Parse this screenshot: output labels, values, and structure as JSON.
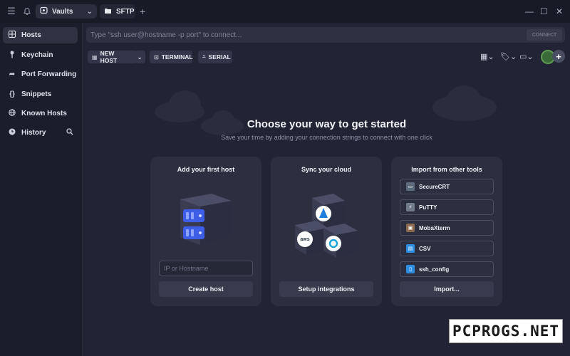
{
  "titlebar": {
    "tabs": [
      {
        "label": "Vaults",
        "icon": "vault-icon"
      },
      {
        "label": "SFTP",
        "icon": "folder-icon"
      }
    ]
  },
  "sidebar": {
    "items": [
      {
        "label": "Hosts",
        "icon": "grid-icon",
        "active": true
      },
      {
        "label": "Keychain",
        "icon": "key-icon"
      },
      {
        "label": "Port Forwarding",
        "icon": "arrow-forward-icon"
      },
      {
        "label": "Snippets",
        "icon": "braces-icon"
      },
      {
        "label": "Known Hosts",
        "icon": "globe-icon"
      },
      {
        "label": "History",
        "icon": "clock-icon"
      }
    ]
  },
  "connect": {
    "placeholder": "Type \"ssh user@hostname -p port\" to connect...",
    "button_label": "CONNECT"
  },
  "toolbar": {
    "new_host_label": "NEW HOST",
    "terminal_label": "TERMINAL",
    "serial_label": "SERIAL"
  },
  "main": {
    "heading": "Choose your way to get started",
    "subheading": "Save your time by adding your connection strings to connect with one click"
  },
  "cards": {
    "add_host": {
      "title": "Add your first host",
      "input_placeholder": "IP or Hostname",
      "button_label": "Create host"
    },
    "sync_cloud": {
      "title": "Sync your cloud",
      "button_label": "Setup integrations"
    },
    "import": {
      "title": "Import from other tools",
      "items": [
        {
          "label": "SecureCRT",
          "icon": "securecrt-icon"
        },
        {
          "label": "PuTTY",
          "icon": "putty-icon"
        },
        {
          "label": "MobaXterm",
          "icon": "mobaxterm-icon"
        },
        {
          "label": "CSV",
          "icon": "csv-icon"
        },
        {
          "label": "ssh_config",
          "icon": "file-icon"
        }
      ],
      "button_label": "Import..."
    }
  },
  "watermark": "PCPROGS.NET",
  "colors": {
    "background": "#222435",
    "sidebar": "#1b1d2a",
    "card": "#2c2f40",
    "server_accent": "#3f5ee8"
  }
}
